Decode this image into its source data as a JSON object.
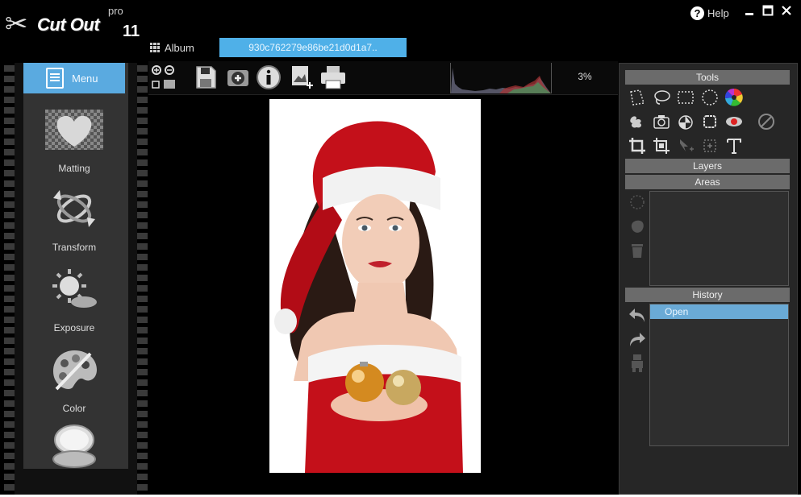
{
  "app": {
    "brand": "Cut Out",
    "edition": "pro",
    "version": "11"
  },
  "titlebar": {
    "help_label": "Help",
    "minimize": "▁",
    "maximize": "☐",
    "close": "✕"
  },
  "tabs": {
    "album_label": "Album",
    "file_label": "930c762279e86be21d0d1a7.."
  },
  "left_menu": {
    "menu_label": "Menu",
    "items": [
      {
        "label": "Matting",
        "icon": "heart-matting-icon"
      },
      {
        "label": "Transform",
        "icon": "transform-rotate-icon"
      },
      {
        "label": "Exposure",
        "icon": "exposure-sun-icon"
      },
      {
        "label": "Color",
        "icon": "color-palette-icon"
      },
      {
        "label": "",
        "icon": "compact-mirror-icon"
      }
    ]
  },
  "toolbar": {
    "zoom_level": "3%"
  },
  "right_panel": {
    "tools_title": "Tools",
    "layers_title": "Layers",
    "areas_title": "Areas",
    "history_title": "History",
    "history_items": [
      "Open"
    ]
  },
  "colors": {
    "accent": "#4fb0e8",
    "panel_header": "#6b6b6b",
    "panel_bg": "#262626"
  }
}
